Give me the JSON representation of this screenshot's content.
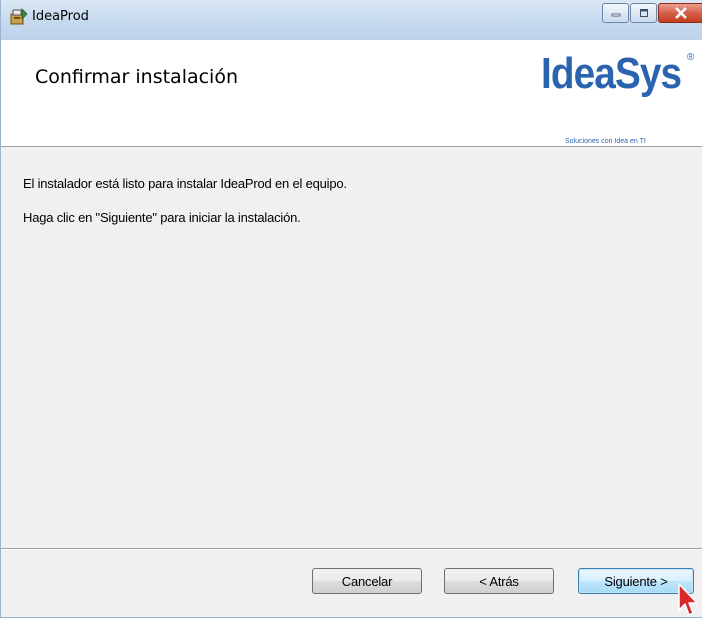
{
  "window": {
    "title": "IdeaProd",
    "app_icon": "installer-icon",
    "caption_buttons": {
      "minimize_icon": "minimize-icon",
      "maximize_icon": "maximize-icon",
      "close_icon": "close-icon"
    }
  },
  "banner": {
    "title": "Confirmar instalación",
    "logo": {
      "wordmark_part1": "Idea",
      "wordmark_part2": "Sys",
      "registered": "®",
      "tagline": "Soluciones con Idea en TI"
    }
  },
  "body": {
    "line1": "El instalador está listo para instalar IdeaProd en el equipo.",
    "line2": "Haga clic en \"Siguiente\" para iniciar la instalación."
  },
  "buttons": {
    "cancel": "Cancelar",
    "back": "< Atrás",
    "next": "Siguiente >"
  },
  "colors": {
    "brand_blue": "#2a64b0",
    "close_red": "#c43c20"
  }
}
